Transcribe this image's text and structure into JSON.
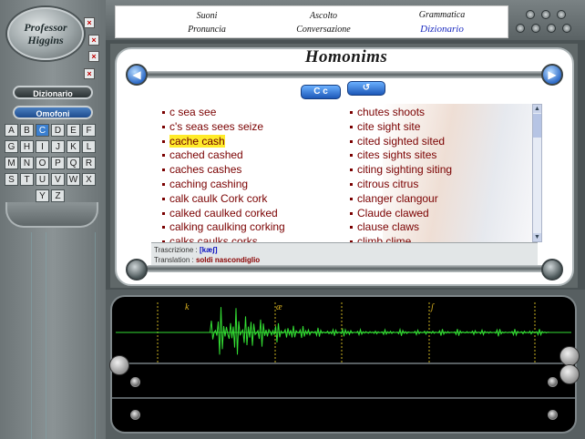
{
  "app": {
    "logo_line1": "Professor",
    "logo_line2": "Higgins"
  },
  "sidebar": {
    "section_button": "Dizionario",
    "mode_button": "Omofoni",
    "letters": [
      "A",
      "B",
      "C",
      "D",
      "E",
      "F",
      "G",
      "H",
      "I",
      "J",
      "K",
      "L",
      "M",
      "N",
      "O",
      "P",
      "Q",
      "R",
      "S",
      "T",
      "U",
      "V",
      "W",
      "X",
      "Y",
      "Z"
    ],
    "selected_letter": "C"
  },
  "menu": {
    "items": [
      {
        "label": "Suoni"
      },
      {
        "label": "Ascolto"
      },
      {
        "label": "Grammatica"
      },
      {
        "label": "Pronuncia"
      },
      {
        "label": "Conversazione"
      },
      {
        "label": "Dizionario"
      }
    ],
    "active": "Dizionario"
  },
  "panel": {
    "title": "Homonims",
    "case_button": "C c",
    "back_button": "↺",
    "nav_prev_icon": "triangle-left",
    "nav_next_icon": "triangle-right"
  },
  "words": {
    "column1": [
      "c sea see",
      "c's seas sees seize",
      "cache cash",
      "cached cashed",
      "caches cashes",
      "caching cashing",
      "calk caulk Cork cork",
      "calked caulked corked",
      "calking caulking corking",
      "calks caulks corks"
    ],
    "column2": [
      "chutes shoots",
      "cite sight site",
      "cited sighted sited",
      "cites sights sites",
      "citing sighting siting",
      "citrous citrus",
      "clanger clangour",
      "Claude clawed",
      "clause claws",
      "climb clime"
    ],
    "highlighted": "cache cash"
  },
  "info": {
    "transcription_label": "Trascrizione :",
    "transcription_value": "[kæʃ]",
    "translation_label": "Translation :",
    "translation_value": "soldi nascondiglio"
  },
  "waveform": {
    "phonemes": [
      "k",
      "æ",
      "ʃ"
    ],
    "color": "#33dd33"
  }
}
